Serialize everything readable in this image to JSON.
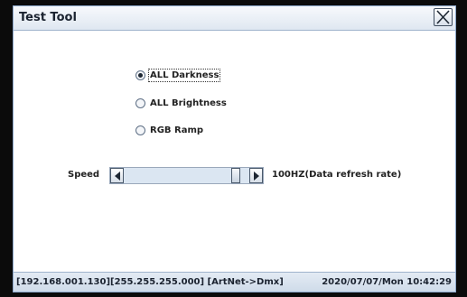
{
  "window": {
    "title": "Test Tool",
    "close_icon": "close-icon"
  },
  "mode_options": [
    {
      "label": "ALL Darkness",
      "selected": true
    },
    {
      "label": "ALL Brightness",
      "selected": false
    },
    {
      "label": "RGB Ramp",
      "selected": false
    }
  ],
  "speed": {
    "label": "Speed",
    "value_text": "100HZ(Data refresh rate)",
    "slider_fraction": 0.92,
    "left_icon": "triangle-left-icon",
    "right_icon": "triangle-right-icon"
  },
  "status": {
    "network": "[192.168.001.130][255.255.255.000] [ArtNet->Dmx]",
    "datetime": "2020/07/07/Mon 10:42:29"
  },
  "colors": {
    "accent": "#8ea9cc",
    "background": "#ffffff"
  }
}
